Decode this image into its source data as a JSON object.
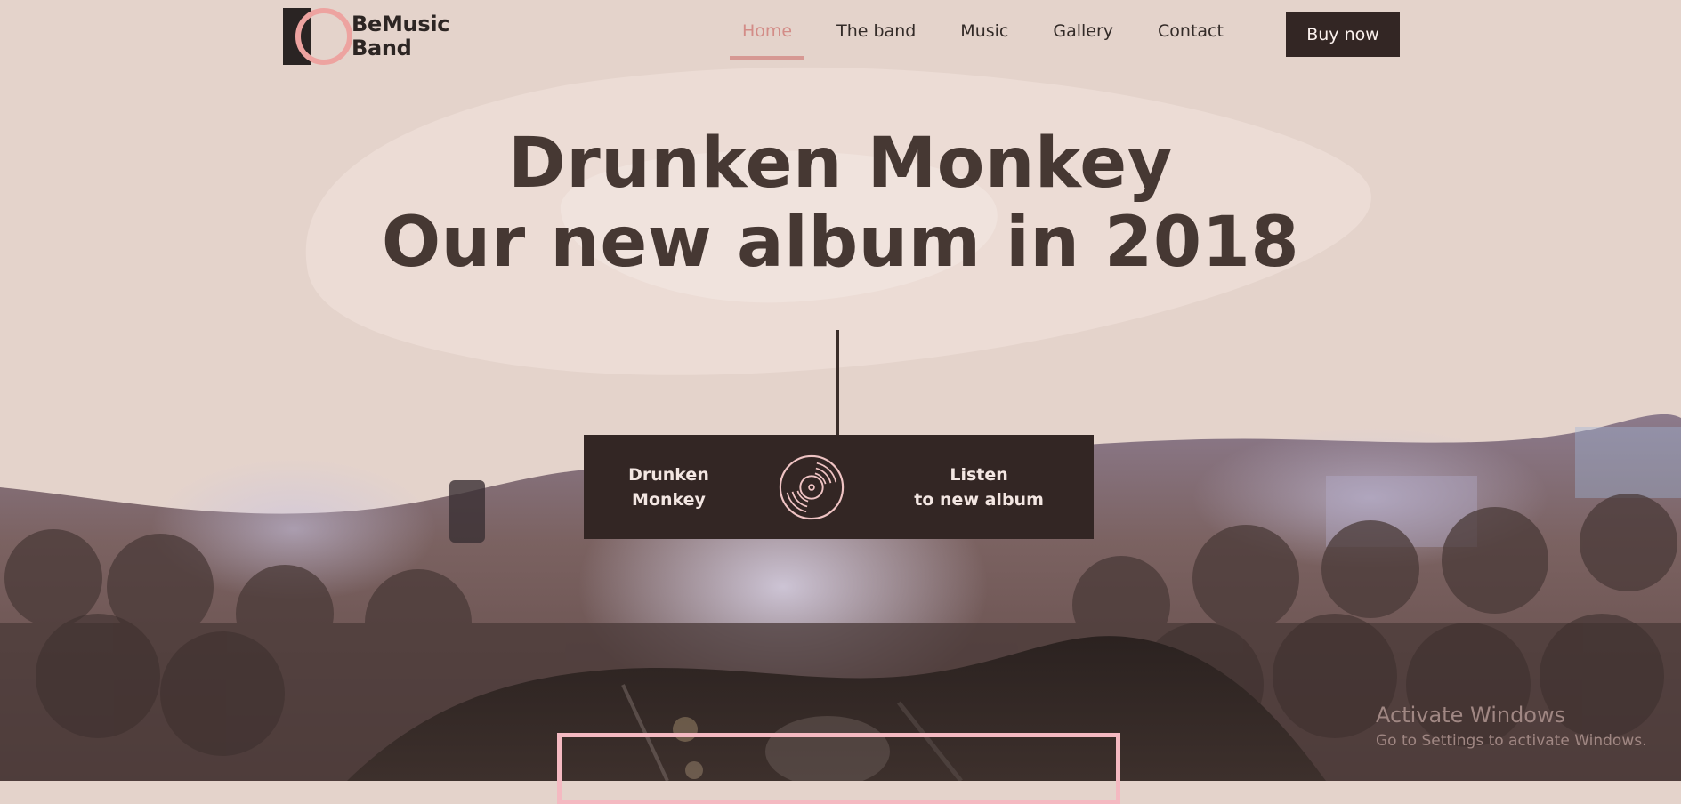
{
  "brand": {
    "line1": "BeMusic",
    "line2": "Band"
  },
  "nav": {
    "items": [
      {
        "label": "Home",
        "active": true
      },
      {
        "label": "The band",
        "active": false
      },
      {
        "label": "Music",
        "active": false
      },
      {
        "label": "Gallery",
        "active": false
      },
      {
        "label": "Contact",
        "active": false
      }
    ],
    "cta": "Buy now"
  },
  "hero": {
    "title_line1": "Drunken Monkey",
    "title_line2": "Our new album in 2018"
  },
  "album": {
    "name_line1": "Drunken",
    "name_line2": "Monkey",
    "cta_line1": "Listen",
    "cta_line2": "to new album",
    "icon": "vinyl-record-icon"
  },
  "watermark": {
    "title": "Activate Windows",
    "subtitle": "Go to Settings to activate Windows."
  },
  "colors": {
    "background": "#e4d3cb",
    "accent": "#d38c87",
    "dark": "#332624",
    "frame": "#f4b9c1"
  }
}
